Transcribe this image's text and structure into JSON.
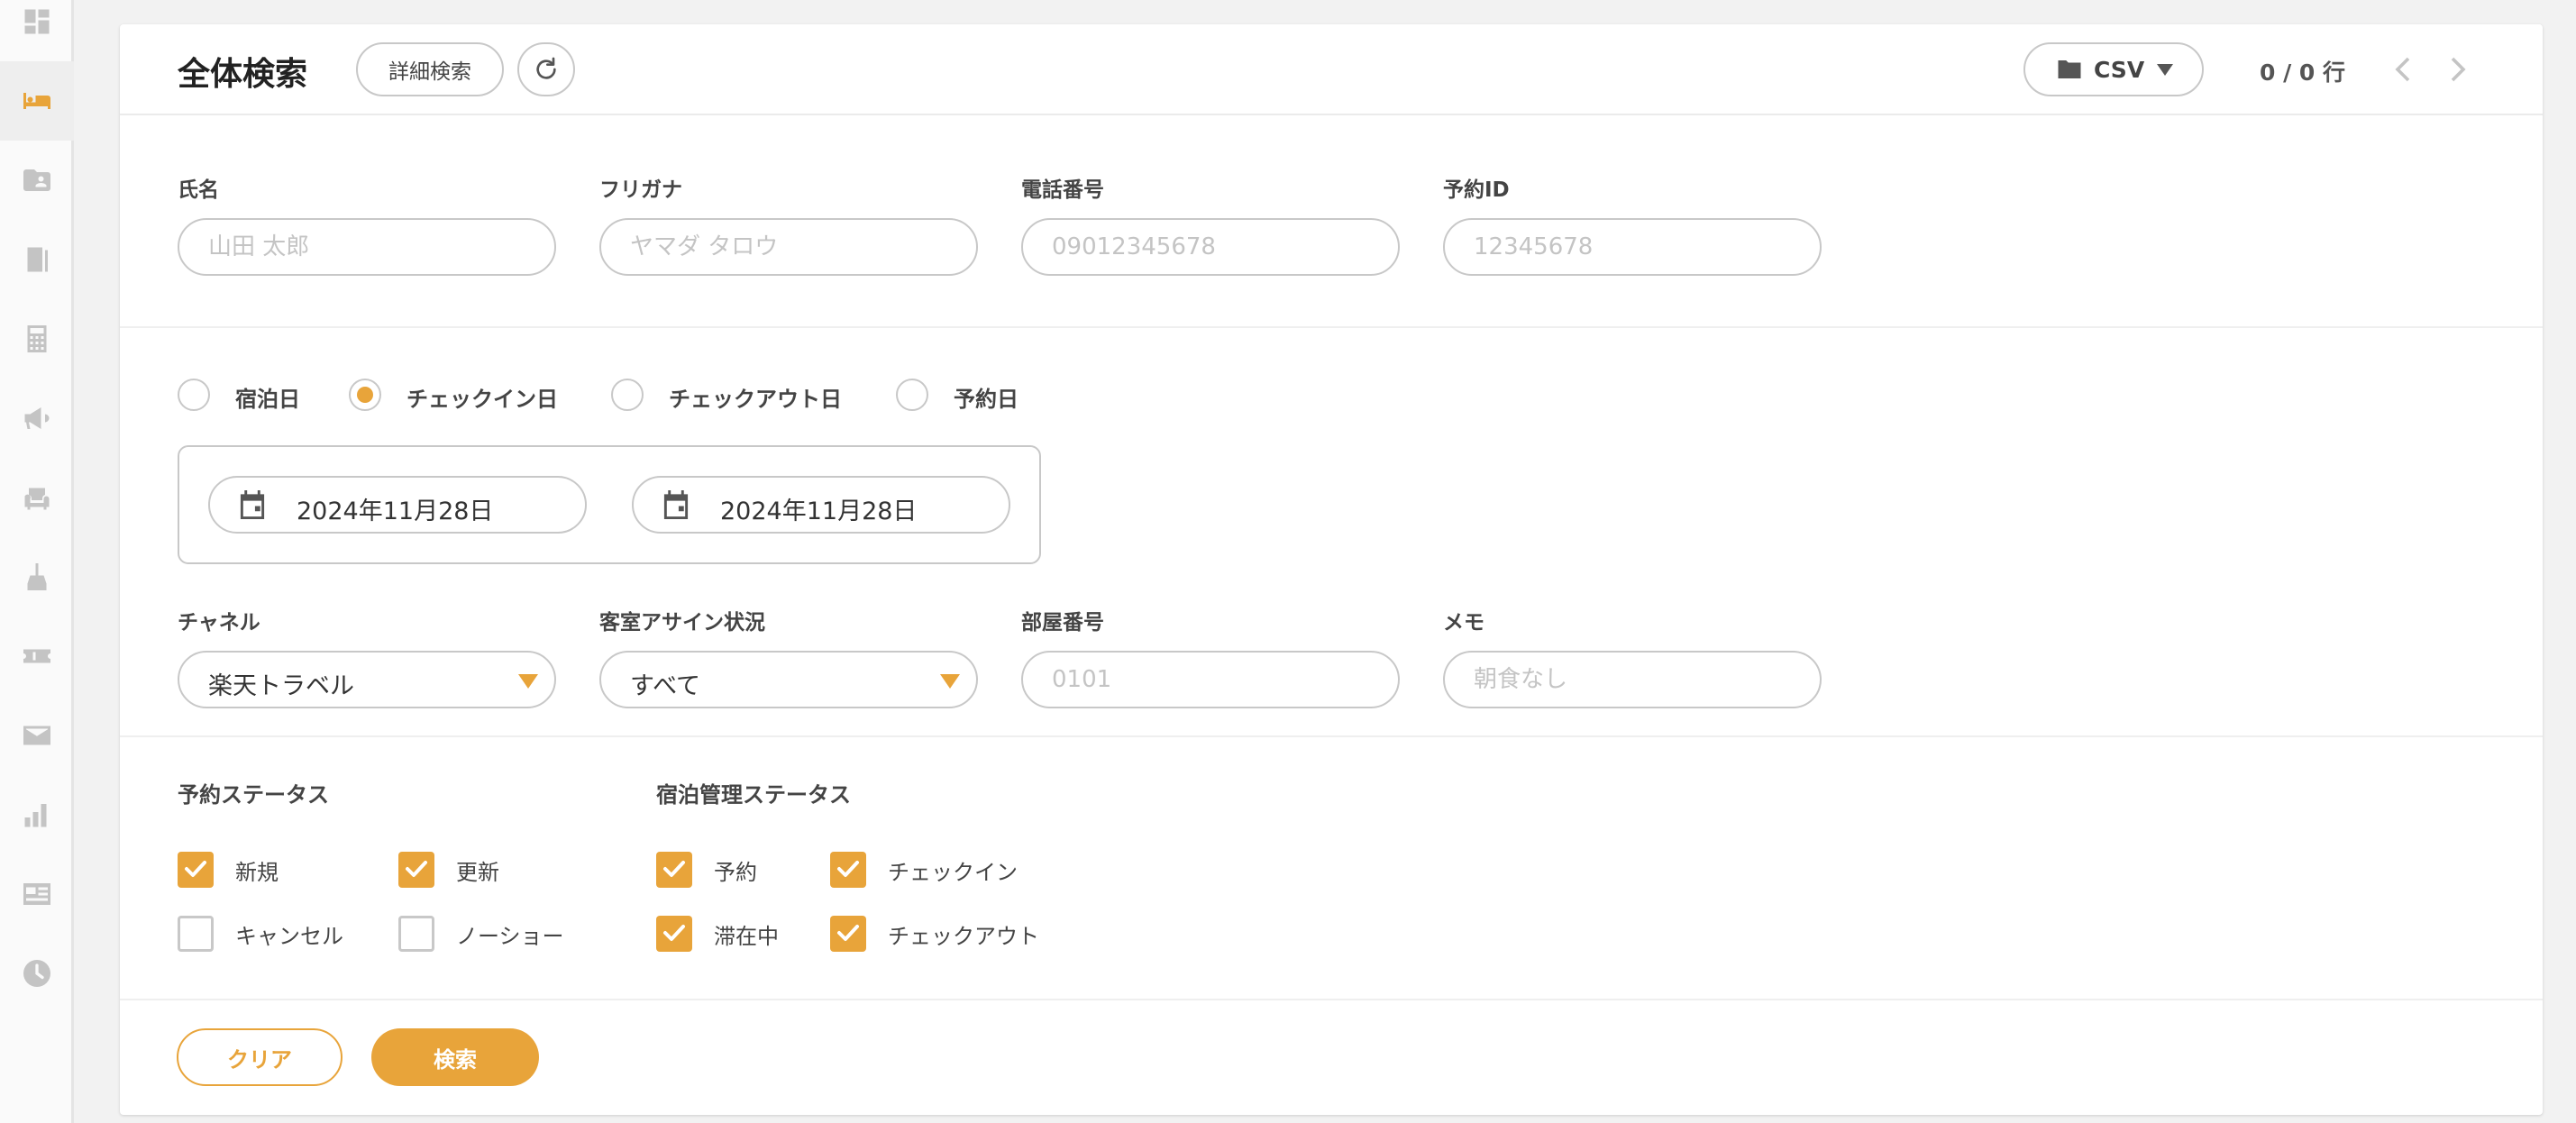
{
  "header": {
    "title": "全体検索",
    "advanced_search_label": "詳細検索",
    "refresh_icon": "refresh-icon",
    "csv_label": "CSV",
    "pager_text": "0 / 0 行"
  },
  "sidebar": {
    "items": [
      {
        "icon": "dashboard-icon",
        "active": false
      },
      {
        "icon": "bed-icon",
        "active": true
      },
      {
        "icon": "contact-folder-icon",
        "active": false
      },
      {
        "icon": "door-icon",
        "active": false
      },
      {
        "icon": "calculator-icon",
        "active": false
      },
      {
        "icon": "megaphone-icon",
        "active": false
      },
      {
        "icon": "armchair-icon",
        "active": false
      },
      {
        "icon": "broom-icon",
        "active": false
      },
      {
        "icon": "ticket-icon",
        "active": false
      },
      {
        "icon": "mail-icon",
        "active": false
      },
      {
        "icon": "bar-chart-icon",
        "active": false
      },
      {
        "icon": "newspaper-icon",
        "active": false
      },
      {
        "icon": "clock-icon",
        "active": false
      }
    ]
  },
  "fields": {
    "name": {
      "label": "氏名",
      "placeholder": "山田 太郎"
    },
    "kana": {
      "label": "フリガナ",
      "placeholder": "ヤマダ タロウ"
    },
    "phone": {
      "label": "電話番号",
      "placeholder": "09012345678"
    },
    "reservation_id": {
      "label": "予約ID",
      "placeholder": "12345678"
    }
  },
  "date_type": {
    "options": [
      "宿泊日",
      "チェックイン日",
      "チェックアウト日",
      "予約日"
    ],
    "selected": "チェックイン日"
  },
  "date_range": {
    "from": "2024年11月28日",
    "separator": "~",
    "to": "2024年11月28日"
  },
  "filters": {
    "channel": {
      "label": "チャネル",
      "value": "楽天トラベル"
    },
    "room_assign": {
      "label": "客室アサイン状況",
      "value": "すべて"
    },
    "room_number": {
      "label": "部屋番号",
      "placeholder": "0101"
    },
    "memo": {
      "label": "メモ",
      "placeholder": "朝食なし"
    }
  },
  "reservation_status": {
    "label": "予約ステータス",
    "items": [
      {
        "label": "新規",
        "checked": true
      },
      {
        "label": "更新",
        "checked": true
      },
      {
        "label": "キャンセル",
        "checked": false
      },
      {
        "label": "ノーショー",
        "checked": false
      }
    ]
  },
  "stay_status": {
    "label": "宿泊管理ステータス",
    "items": [
      {
        "label": "予約",
        "checked": true
      },
      {
        "label": "チェックイン",
        "checked": true
      },
      {
        "label": "滞在中",
        "checked": true
      },
      {
        "label": "チェックアウト",
        "checked": true
      }
    ]
  },
  "actions": {
    "clear_label": "クリア",
    "search_label": "検索"
  },
  "colors": {
    "accent": "#e8a43a",
    "border": "#c8c8c8"
  }
}
